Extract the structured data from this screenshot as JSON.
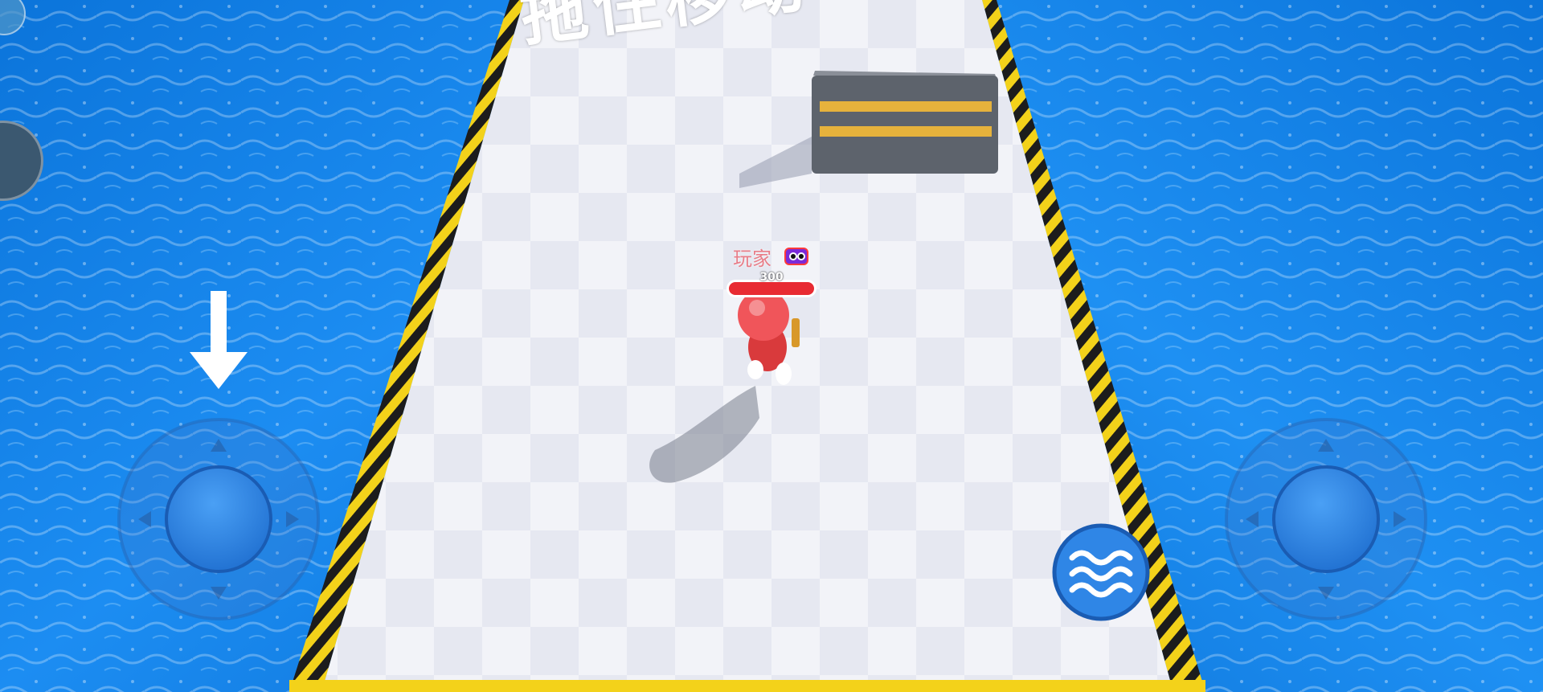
{
  "hud": {
    "hint_text": "拖住移动",
    "player_name": "玩家",
    "hp_value": "300",
    "hp_fraction": 1.0
  },
  "controls": {
    "move_joystick": "move-joystick",
    "aim_joystick": "aim-joystick",
    "skill_button_icon": "wave-icon",
    "tutorial_arrow_icon": "arrow-down-icon"
  },
  "colors": {
    "water": "#1b8cf0",
    "joystick_knob": "#2f86e6",
    "hp_bar": "#e82b32",
    "player": "#e84a4a",
    "hazard_yellow": "#f3d21a"
  }
}
